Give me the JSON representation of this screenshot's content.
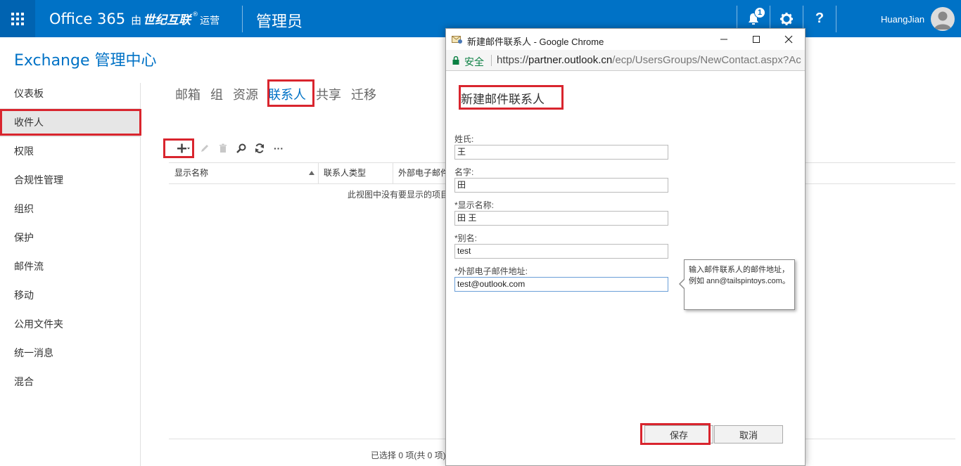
{
  "topbar": {
    "brand": "Office 365",
    "brand_by": "由",
    "brand_vendor": "世纪互联",
    "brand_vendor_mark": "®",
    "brand_operated": "运营",
    "admin_title": "管理员",
    "notification_count": "1",
    "help_label": "?",
    "username": "HuangJian",
    "accent_color": "#0072c6"
  },
  "page": {
    "heading": "Exchange 管理中心"
  },
  "sidebar": {
    "items": [
      {
        "label": "仪表板"
      },
      {
        "label": "收件人"
      },
      {
        "label": "权限"
      },
      {
        "label": "合规性管理"
      },
      {
        "label": "组织"
      },
      {
        "label": "保护"
      },
      {
        "label": "邮件流"
      },
      {
        "label": "移动"
      },
      {
        "label": "公用文件夹"
      },
      {
        "label": "统一消息"
      },
      {
        "label": "混合"
      }
    ],
    "active_index": 1
  },
  "tabs": [
    {
      "label": "邮箱"
    },
    {
      "label": "组"
    },
    {
      "label": "资源"
    },
    {
      "label": "联系人"
    },
    {
      "label": "共享"
    },
    {
      "label": "迁移"
    }
  ],
  "active_tab": 3,
  "toolbar": {
    "icons": [
      "add-icon",
      "edit-icon",
      "delete-icon",
      "search-icon",
      "refresh-icon",
      "more-icon"
    ],
    "more_label": "···"
  },
  "grid": {
    "columns": [
      "显示名称",
      "联系人类型",
      "外部电子邮件"
    ],
    "empty_message": "此视图中没有要显示的项目",
    "status": "已选择 0 项(共 0 项)"
  },
  "popup": {
    "window_title": "新建邮件联系人 - Google Chrome",
    "secure_label": "安全",
    "url_scheme": "https://",
    "url_host": "partner.outlook.cn",
    "url_path": "/ecp/UsersGroups/NewContact.aspx?Ac",
    "form_title": "新建邮件联系人",
    "fields": [
      {
        "label": "姓氏:",
        "value": "王"
      },
      {
        "label": "名字:",
        "value": "田"
      },
      {
        "label": "*显示名称:",
        "value": "田 王"
      },
      {
        "label": "*别名:",
        "value": "test"
      },
      {
        "label": "*外部电子邮件地址:",
        "value": "test@outlook.com"
      }
    ],
    "tooltip": "输入邮件联系人的邮件地址，例如 ann@tailspintoys.com。",
    "save_label": "保存",
    "cancel_label": "取消"
  },
  "highlight_color": "#d9252e"
}
